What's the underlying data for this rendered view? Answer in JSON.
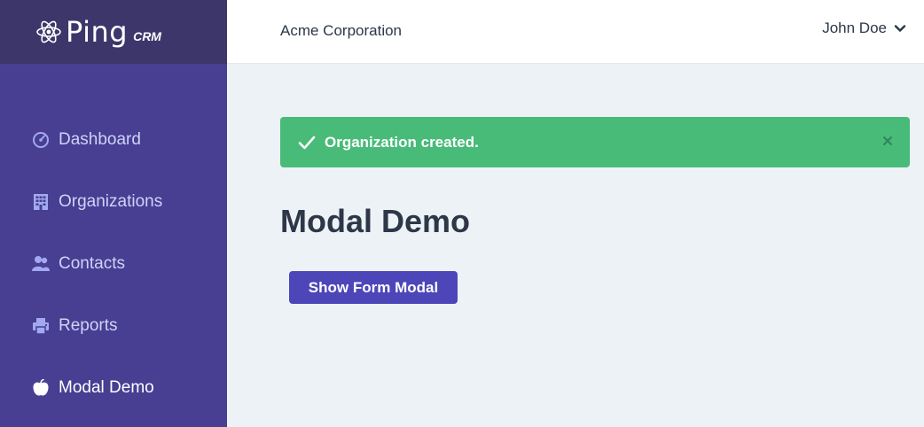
{
  "brand": {
    "name": "Ping",
    "suffix": "CRM"
  },
  "header": {
    "organization": "Acme Corporation",
    "user_name": "John Doe"
  },
  "sidebar": {
    "items": [
      {
        "label": "Dashboard",
        "icon": "dashboard-icon"
      },
      {
        "label": "Organizations",
        "icon": "office-icon"
      },
      {
        "label": "Contacts",
        "icon": "users-icon"
      },
      {
        "label": "Reports",
        "icon": "printer-icon"
      },
      {
        "label": "Modal Demo",
        "icon": "apple-icon",
        "active": true
      }
    ]
  },
  "flash": {
    "message": "Organization created.",
    "color": "#48bb78"
  },
  "main": {
    "title": "Modal Demo",
    "button_label": "Show Form Modal"
  },
  "colors": {
    "sidebar": "#483e92",
    "logo_bar": "#3c366b",
    "accent": "#4c46b8",
    "background": "#edf2f7"
  }
}
